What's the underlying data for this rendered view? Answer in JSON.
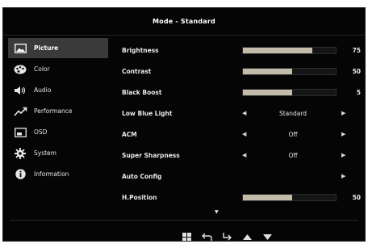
{
  "header": {
    "title": "Mode - Standard"
  },
  "colors": {
    "accent_fill": "#c3bcaa",
    "background": "#050505",
    "active_item_bg": "#3a3a3a"
  },
  "sidebar": {
    "items": [
      {
        "label": "Picture",
        "icon": "picture-icon",
        "active": true
      },
      {
        "label": "Color",
        "icon": "color-palette-icon",
        "active": false
      },
      {
        "label": "Audio",
        "icon": "speaker-icon",
        "active": false
      },
      {
        "label": "Performance",
        "icon": "performance-chart-icon",
        "active": false
      },
      {
        "label": "OSD",
        "icon": "osd-window-icon",
        "active": false
      },
      {
        "label": "System",
        "icon": "gear-icon",
        "active": false
      },
      {
        "label": "Information",
        "icon": "info-icon",
        "active": false
      }
    ]
  },
  "settings": {
    "brightness": {
      "label": "Brightness",
      "value": "75",
      "level": 0.75
    },
    "contrast": {
      "label": "Contrast",
      "value": "50",
      "level": 0.53
    },
    "black_boost": {
      "label": "Black Boost",
      "value": "5",
      "level": 0.53
    },
    "low_blue_light": {
      "label": "Low Blue Light",
      "value": "Standard"
    },
    "acm": {
      "label": "ACM",
      "value": "Off"
    },
    "super_sharpness": {
      "label": "Super Sharpness",
      "value": "Off"
    },
    "auto_config": {
      "label": "Auto Config"
    },
    "h_position": {
      "label": "H.Position",
      "value": "50",
      "level": 0.53
    }
  },
  "footer": {
    "buttons": [
      "menu-grid-icon",
      "back-icon",
      "enter-icon",
      "up-arrow-icon",
      "down-arrow-icon"
    ]
  }
}
